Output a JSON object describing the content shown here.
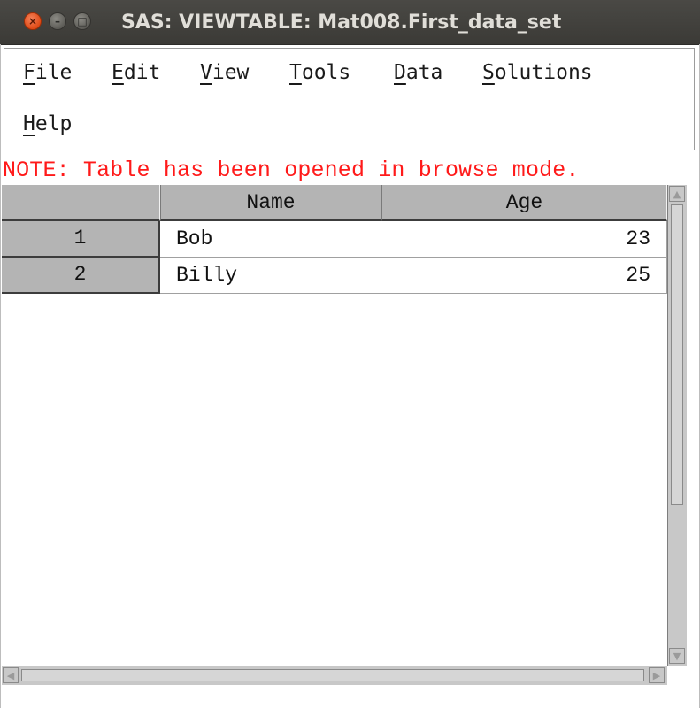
{
  "window": {
    "title": "SAS: VIEWTABLE: Mat008.First_data_set",
    "close_glyph": "×",
    "minimize_glyph": "–",
    "maximize_glyph": "□"
  },
  "menubar": {
    "items": [
      {
        "underline": "F",
        "rest": "ile"
      },
      {
        "underline": "E",
        "rest": "dit"
      },
      {
        "underline": "V",
        "rest": "iew"
      },
      {
        "underline": "T",
        "rest": "ools"
      },
      {
        "underline": "D",
        "rest": "ata"
      },
      {
        "underline": "S",
        "rest": "olutions"
      },
      {
        "underline": "H",
        "rest": "elp"
      }
    ]
  },
  "note": "NOTE: Table has been opened in browse mode.",
  "table": {
    "columns": [
      "Name",
      "Age"
    ],
    "rows": [
      {
        "num": "1",
        "name": "Bob",
        "age": "23"
      },
      {
        "num": "2",
        "name": "Billy",
        "age": "25"
      }
    ]
  },
  "scroll_arrows": {
    "up": "▲",
    "down": "▼",
    "left": "◀",
    "right": "▶"
  },
  "colors": {
    "note": "#ff1a1a",
    "header_bg": "#b4b4b4",
    "titlebar_bg": "#3b3a36",
    "close_button": "#df4a16"
  }
}
